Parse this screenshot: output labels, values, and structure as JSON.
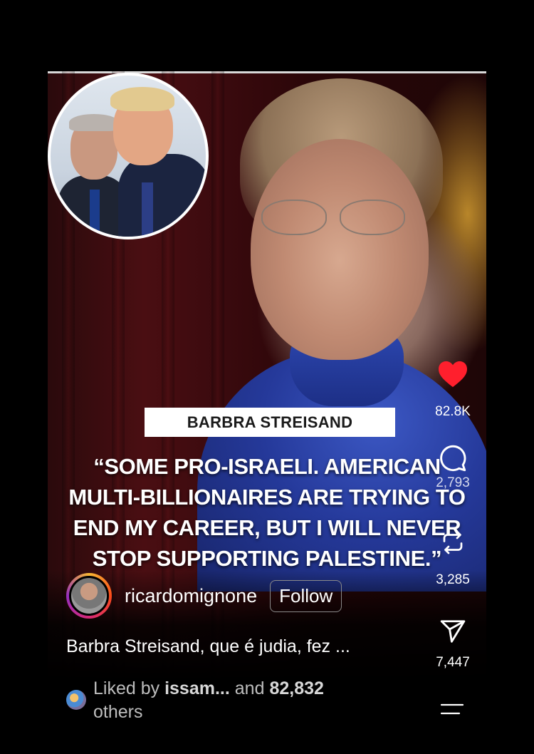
{
  "reel": {
    "name_tag": "BARBRA STREISAND",
    "quote_lines": [
      "“SOME PRO-ISRAELI. AMERICAN",
      "MULTI-BILLIONAIRES ARE TRYING TO",
      "END MY CAREER, BUT I WILL NEVER",
      "STOP SUPPORTING PALESTINE.”"
    ]
  },
  "actions": {
    "like_count": "82.8K",
    "comment_count": "2,793",
    "repost_count": "3,285",
    "share_count": "7,447",
    "like_color": "#ff1f2d"
  },
  "author": {
    "username": "ricardomignone",
    "follow_label": "Follow"
  },
  "caption": "Barbra Streisand, que é judia, fez ...",
  "likes": {
    "prefix": "Liked by",
    "user": "issam...",
    "middle": "and",
    "count": "82,832",
    "suffix": "others"
  }
}
